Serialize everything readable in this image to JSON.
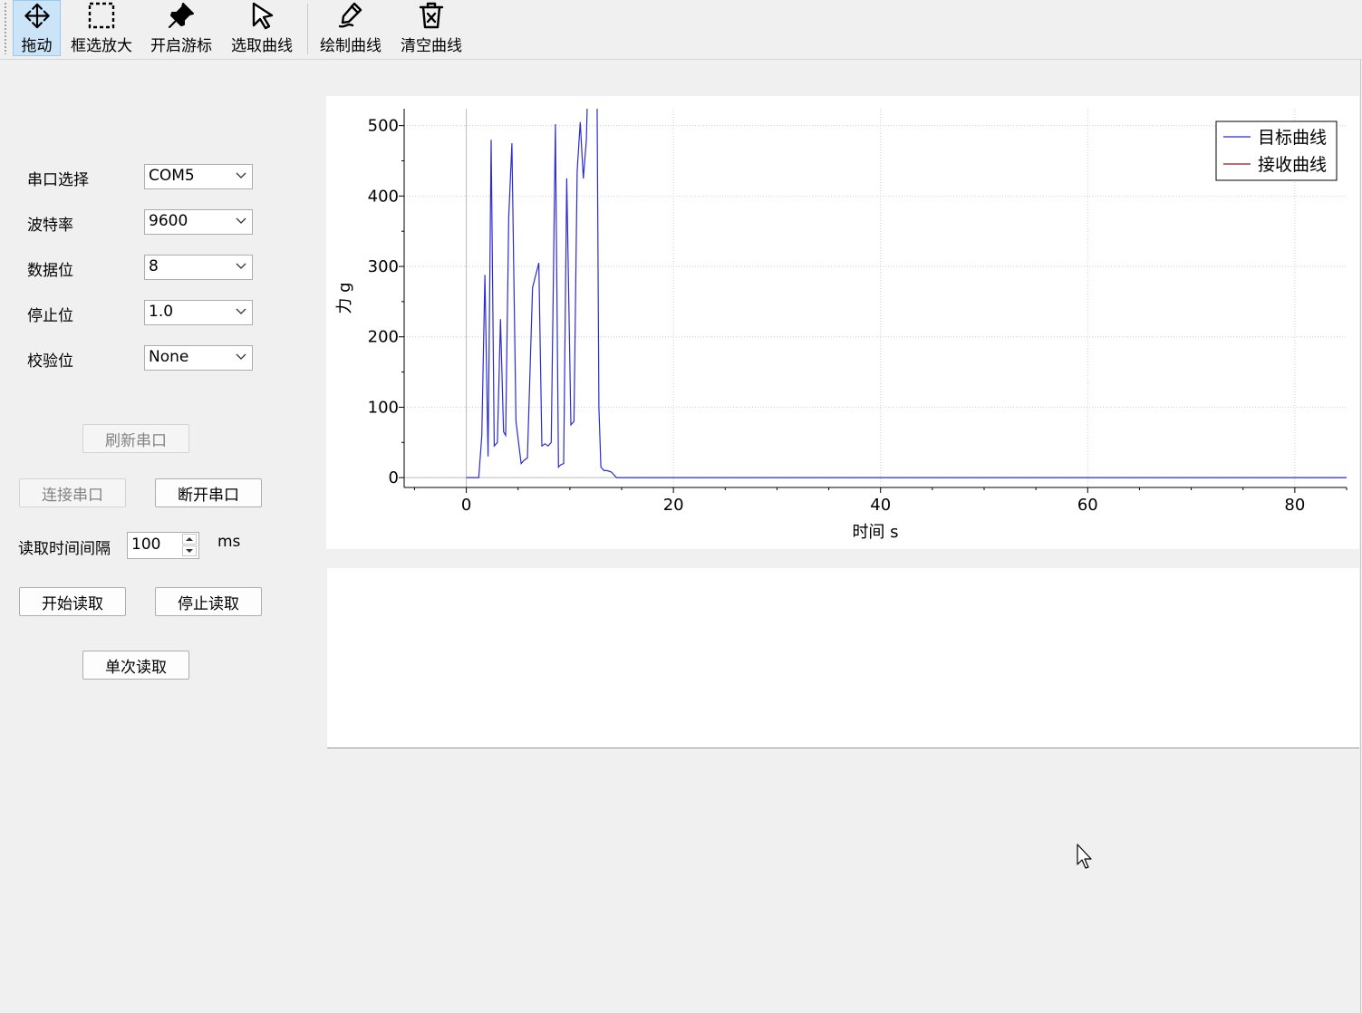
{
  "toolbar": {
    "items": [
      {
        "label": "拖动",
        "icon": "move-icon",
        "active": true
      },
      {
        "label": "框选放大",
        "icon": "box-select-icon",
        "active": false
      },
      {
        "label": "开启游标",
        "icon": "cursor-pin-icon",
        "active": false
      },
      {
        "label": "选取曲线",
        "icon": "arrow-pointer-icon",
        "active": false
      },
      {
        "label": "绘制曲线",
        "icon": "draw-curve-icon",
        "active": false
      },
      {
        "label": "清空曲线",
        "icon": "trash-icon",
        "active": false
      }
    ]
  },
  "serial": {
    "port_label": "串口选择",
    "port_value": "COM5",
    "baud_label": "波特率",
    "baud_value": "9600",
    "databits_label": "数据位",
    "databits_value": "8",
    "stopbits_label": "停止位",
    "stopbits_value": "1.0",
    "parity_label": "校验位",
    "parity_value": "None"
  },
  "buttons": {
    "refresh": "刷新串口",
    "connect": "连接串口",
    "disconnect": "断开串口",
    "start": "开始读取",
    "stop": "停止读取",
    "single": "单次读取"
  },
  "interval": {
    "label": "读取时间间隔",
    "value": "100",
    "unit": "ms"
  },
  "chart_data": {
    "type": "line",
    "xlabel": "时间 s",
    "ylabel": "力 g",
    "xlim": [
      -6,
      85
    ],
    "ylim": [
      -14,
      524
    ],
    "xticks": [
      0,
      20,
      40,
      60,
      80
    ],
    "yticks": [
      0,
      100,
      200,
      300,
      400,
      500
    ],
    "grid": true,
    "legend": "top-right",
    "colors": {
      "目标曲线": "#2b2bd4",
      "接收曲线": "#8b1a1a"
    },
    "series": [
      {
        "name": "目标曲线",
        "x": [
          0,
          1.2,
          1.5,
          1.8,
          2.1,
          2.4,
          2.7,
          3.0,
          3.3,
          3.6,
          3.8,
          4.1,
          4.4,
          4.8,
          5.3,
          5.6,
          5.9,
          6.4,
          7.0,
          7.3,
          7.6,
          7.9,
          8.2,
          8.6,
          8.9,
          9.1,
          9.4,
          9.7,
          10.1,
          10.4,
          10.7,
          11.0,
          11.3,
          11.6,
          11.8,
          12.1,
          12.4,
          12.6,
          12.8,
          13.0,
          13.3,
          13.6,
          14.0,
          14.5,
          14.8,
          20,
          40,
          60,
          80,
          85
        ],
        "y": [
          0,
          0,
          60,
          288,
          30,
          480,
          45,
          50,
          225,
          65,
          60,
          370,
          475,
          80,
          20,
          25,
          28,
          270,
          305,
          45,
          48,
          45,
          50,
          502,
          15,
          18,
          20,
          425,
          75,
          80,
          435,
          505,
          425,
          480,
          600,
          600,
          600,
          600,
          100,
          15,
          10,
          10,
          8,
          0,
          0,
          0,
          0,
          0,
          0,
          0
        ]
      },
      {
        "name": "接收曲线",
        "x": [],
        "y": []
      }
    ]
  }
}
